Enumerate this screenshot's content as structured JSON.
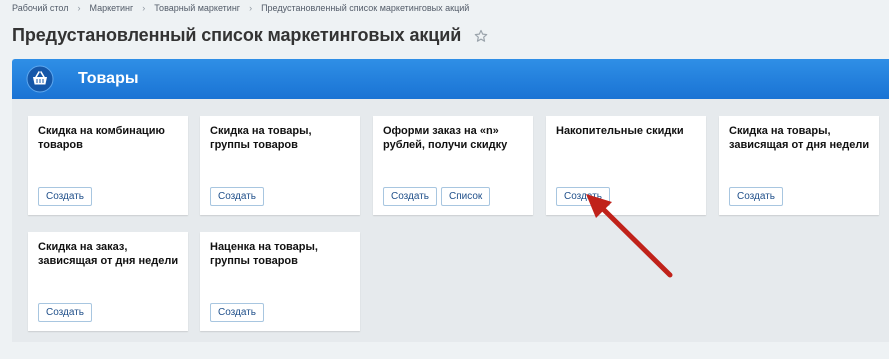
{
  "breadcrumb": {
    "items": [
      "Рабочий стол",
      "Маркетинг",
      "Товарный маркетинг",
      "Предустановленный список маркетинговых акций"
    ]
  },
  "page": {
    "title": "Предустановленный список маркетинговых акций",
    "favorite_icon": "star-icon"
  },
  "section": {
    "title": "Товары",
    "icon": "basket-icon",
    "accent": "#2067c8"
  },
  "cards": [
    {
      "title": "Скидка на комбинацию товаров",
      "buttons": [
        "Создать"
      ]
    },
    {
      "title": "Скидка на товары, группы товаров",
      "buttons": [
        "Создать"
      ]
    },
    {
      "title": "Оформи заказ на «n» рублей, получи скидку",
      "buttons": [
        "Создать",
        "Список"
      ]
    },
    {
      "title": "Накопительные скидки",
      "buttons": [
        "Создать"
      ]
    },
    {
      "title": "Скидка на товары, зависящая от дня недели",
      "buttons": [
        "Создать"
      ]
    },
    {
      "title": "Скидка на заказ, зависящая от дня недели",
      "buttons": [
        "Создать"
      ]
    },
    {
      "title": "Наценка на товары, группы товаров",
      "buttons": [
        "Создать"
      ]
    }
  ],
  "annotation": {
    "arrow_color": "#c0221a",
    "points_to": "Создать"
  }
}
